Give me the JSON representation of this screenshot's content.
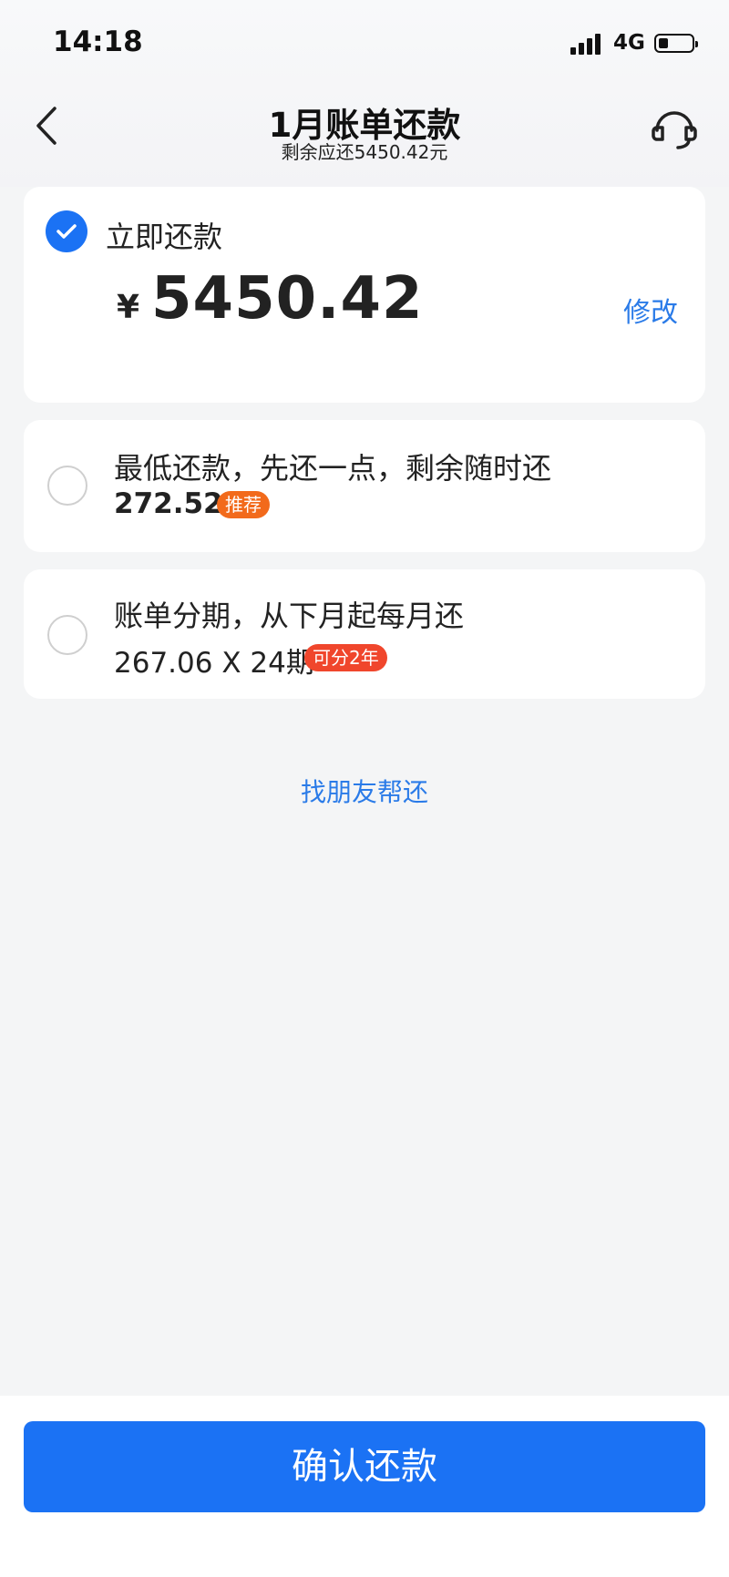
{
  "status_bar": {
    "time": "14:18",
    "network": "4G"
  },
  "nav": {
    "title": "1月账单还款",
    "subtitle": "剩余应还5450.42元"
  },
  "options": {
    "immediate": {
      "label": "立即还款",
      "currency": "¥",
      "amount": "5450.42",
      "modify_label": "修改",
      "selected": true
    },
    "minimum": {
      "label": "最低还款，先还一点，剩余随时还",
      "value": "272.52",
      "badge": "推荐",
      "selected": false
    },
    "installment": {
      "label": "账单分期，从下月起每月还",
      "value": "267.06 X 24期",
      "badge": "可分2年",
      "selected": false
    }
  },
  "friend_link": "找朋友帮还",
  "confirm_button": "确认还款",
  "colors": {
    "accent": "#1b72f4",
    "link": "#2a7be8",
    "badge_recommend": "#f26a1b",
    "badge_installment": "#f0462c"
  },
  "icons": {
    "back": "back-arrow-icon",
    "customer_service": "headset-icon",
    "selected": "checkmark-icon"
  }
}
